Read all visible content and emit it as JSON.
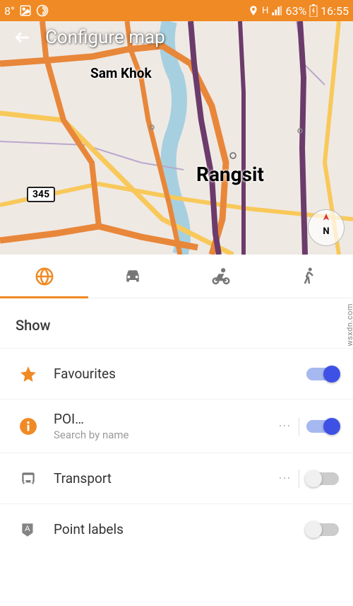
{
  "status": {
    "temperature": "8°",
    "network_label": "H",
    "battery_pct": "63%",
    "time": "16:55"
  },
  "header": {
    "title": "Configure map"
  },
  "map": {
    "labels": {
      "samkhok": "Sam Khok",
      "rangsit": "Rangsit"
    },
    "route_shield": "345",
    "compass_label": "N"
  },
  "tabs": {
    "items": [
      "globe",
      "car",
      "bike",
      "walk"
    ],
    "active_index": 0
  },
  "section": {
    "title": "Show"
  },
  "rows": {
    "favourites": {
      "label": "Favourites",
      "on": true
    },
    "poi": {
      "label": "POI…",
      "sub": "Search by name",
      "on": true,
      "has_overflow": true
    },
    "transport": {
      "label": "Transport",
      "on": false,
      "has_overflow": true
    },
    "point_labels": {
      "label": "Point labels",
      "on": false
    }
  },
  "watermark": "wsxdn.com",
  "colors": {
    "accent": "#f08a24",
    "toggle_on": "#3f51e5"
  }
}
